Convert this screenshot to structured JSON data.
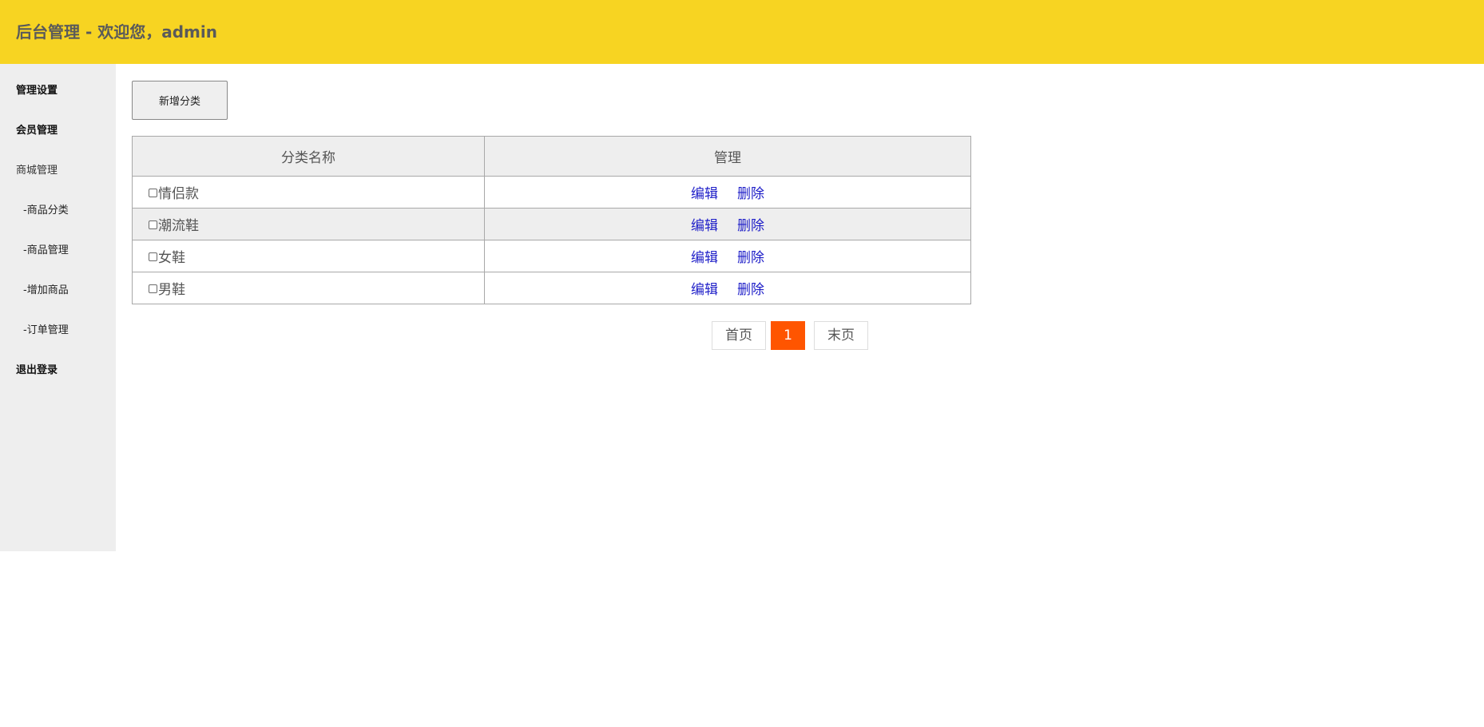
{
  "header": {
    "title": "后台管理 - 欢迎您，admin"
  },
  "sidebar": {
    "items": [
      {
        "label": "管理设置"
      },
      {
        "label": "会员管理"
      },
      {
        "label": "商城管理"
      },
      {
        "label": "-商品分类"
      },
      {
        "label": "-商品管理"
      },
      {
        "label": "-增加商品"
      },
      {
        "label": "-订单管理"
      },
      {
        "label": "退出登录"
      }
    ]
  },
  "toolbar": {
    "add_label": "新增分类"
  },
  "table": {
    "columns": [
      "分类名称",
      "管理"
    ],
    "rows": [
      {
        "name": "情侣款",
        "edit": "编辑",
        "delete": "删除"
      },
      {
        "name": "潮流鞋",
        "edit": "编辑",
        "delete": "删除"
      },
      {
        "name": "女鞋",
        "edit": "编辑",
        "delete": "删除"
      },
      {
        "name": "男鞋",
        "edit": "编辑",
        "delete": "删除"
      }
    ]
  },
  "pagination": {
    "first": "首页",
    "current": "1",
    "last": "末页"
  },
  "colors": {
    "header_bg": "#f7d422",
    "sidebar_bg": "#eeeeee",
    "link": "#1e1ec8",
    "current_page": "#ff5500"
  }
}
